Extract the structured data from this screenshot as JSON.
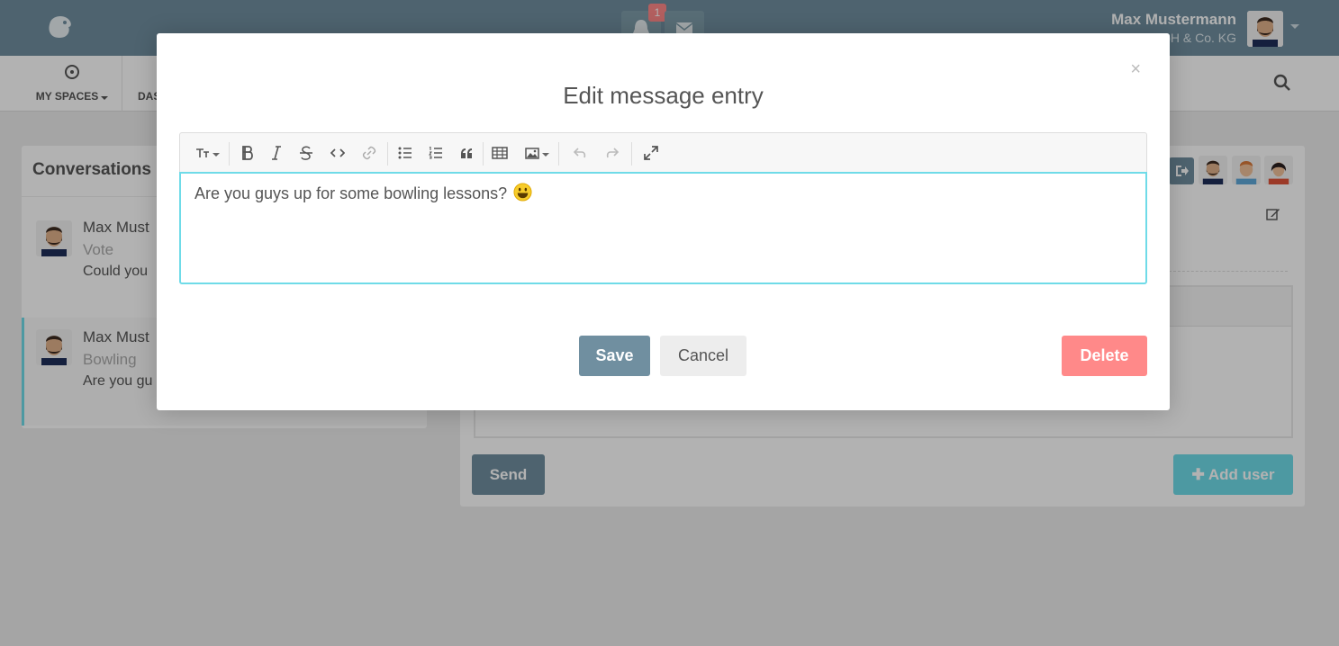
{
  "header": {
    "notification_count": "1",
    "user_name": "Max Mustermann",
    "user_company": "Humhub GmbH & Co. KG"
  },
  "nav": {
    "my_spaces_label": "MY SPACES",
    "dashboard_label": "DAS"
  },
  "conversations": {
    "title": "Conversations",
    "items": [
      {
        "name": "Max Must",
        "subject": "Vote",
        "preview": "Could you"
      },
      {
        "name": "Max Must",
        "subject": "Bowling",
        "preview": "Are you gu"
      }
    ]
  },
  "detail": {
    "send_label": "Send",
    "add_user_label": "Add user"
  },
  "modal": {
    "title": "Edit message entry",
    "close_symbol": "×",
    "message_text": "Are you guys up for some bowling lessons?",
    "save_label": "Save",
    "cancel_label": "Cancel",
    "delete_label": "Delete"
  },
  "colors": {
    "primary": "#708fa0",
    "info": "#6fdbe8",
    "danger": "#ff8989",
    "default": "#ededed"
  }
}
